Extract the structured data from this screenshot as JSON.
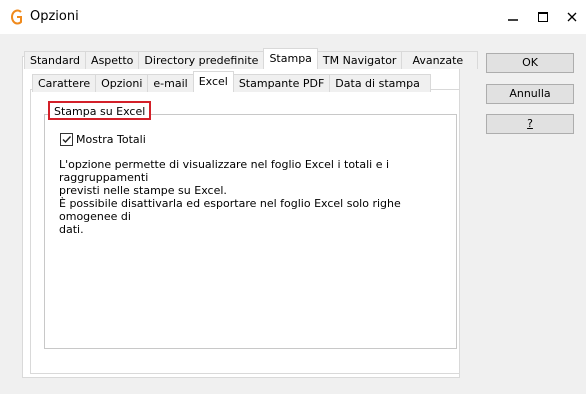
{
  "window": {
    "title": "Opzioni"
  },
  "tabs_outer": [
    "Standard",
    "Aspetto",
    "Directory predefinite",
    "Stampa",
    "TM Navigator",
    "Avanzate"
  ],
  "tabs_inner": [
    "Carattere",
    "Opzioni",
    "e-mail",
    "Excel",
    "Stampante PDF",
    "Data di stampa"
  ],
  "group": {
    "title": "Stampa su Excel"
  },
  "checkbox": {
    "label": "Mostra Totali",
    "checked": true
  },
  "description": {
    "line1": "L'opzione permette di visualizzare nel foglio Excel i totali e i raggruppamenti",
    "line2": "previsti nelle stampe su Excel.",
    "line3": "È possibile disattivarla ed esportare nel foglio Excel solo righe omogenee di",
    "line4": "dati."
  },
  "buttons": {
    "ok": "OK",
    "cancel": "Annulla",
    "help": "?"
  },
  "colors": {
    "highlight": "#d32029",
    "app_icon": "#f08a1c"
  }
}
